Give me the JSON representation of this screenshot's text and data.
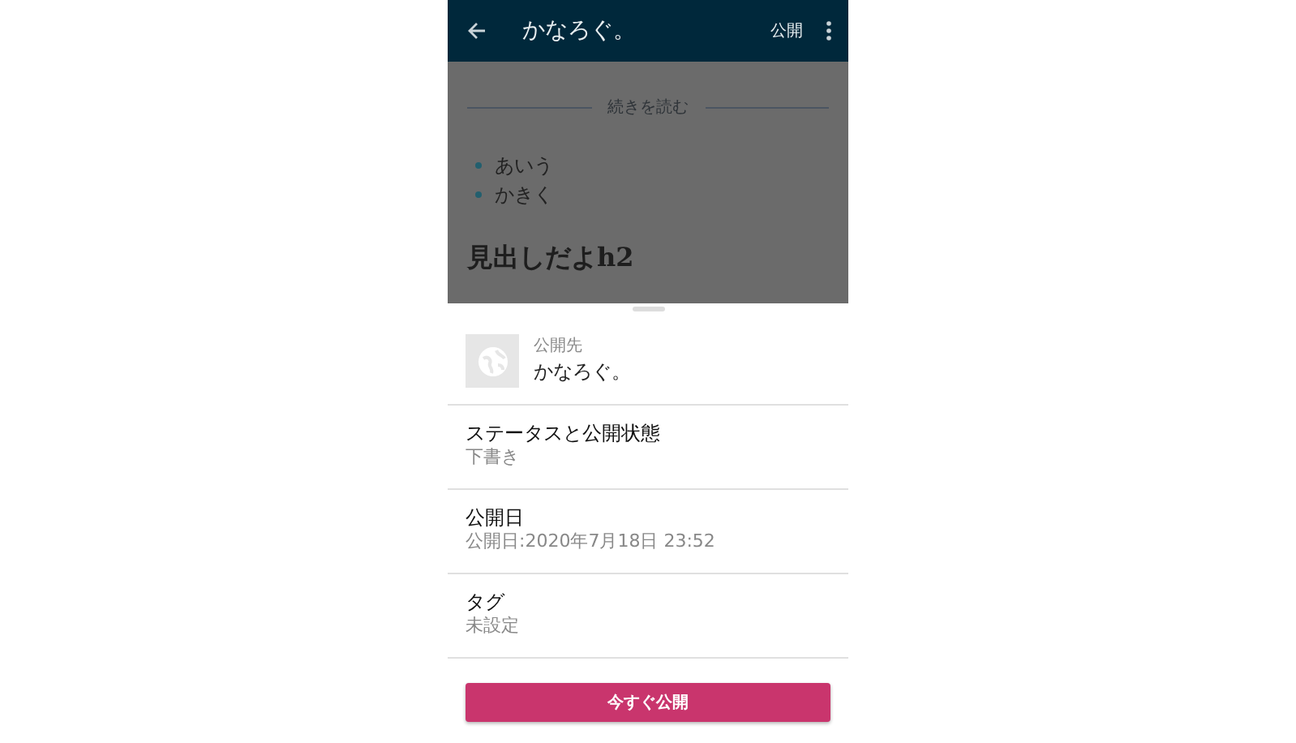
{
  "header": {
    "title": "かなろぐ。",
    "action": "公開"
  },
  "preview": {
    "read_more": "続きを読む",
    "bullets": [
      "あいう",
      "かきく"
    ],
    "heading": "見出しだよh2"
  },
  "sheet": {
    "publisher": {
      "label": "公開先",
      "name": "かなろぐ。"
    },
    "settings": [
      {
        "title": "ステータスと公開状態",
        "value": "下書き"
      },
      {
        "title": "公開日",
        "value": "公開日:2020年7月18日 23:52"
      },
      {
        "title": "タグ",
        "value": "未設定"
      }
    ],
    "publish_button": "今すぐ公開"
  }
}
